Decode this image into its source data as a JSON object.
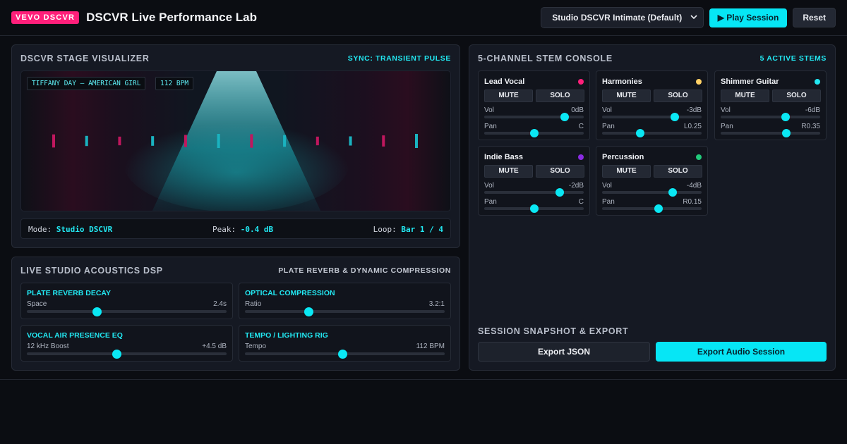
{
  "header": {
    "badge": "VEVO DSCVR",
    "title": "DSCVR Live Performance Lab",
    "preset_select": "Studio DSCVR Intimate (Default)",
    "play_button": "▶ Play Session",
    "reset_button": "Reset"
  },
  "visualizer": {
    "title": "DSCVR STAGE VISUALIZER",
    "sync": "SYNC: TRANSIENT PULSE",
    "track_chip": "TIFFANY DAY — AMERICAN GIRL",
    "bpm_chip": "112 BPM",
    "status": {
      "mode_label": "Mode:",
      "mode_value": "Studio DSCVR",
      "peak_label": "Peak:",
      "peak_value": "-0.4 dB",
      "loop_label": "Loop:",
      "loop_value": "Bar 1 / 4"
    },
    "bars": [
      {
        "color": "#c0175e",
        "level": 0.9
      },
      {
        "color": "#1ab3c0",
        "level": 0.6
      },
      {
        "color": "#c0175e",
        "level": 0.45
      },
      {
        "color": "#1ab3c0",
        "level": 0.55
      },
      {
        "color": "#c0175e",
        "level": 0.8
      },
      {
        "color": "#1ab3c0",
        "level": 1.0
      },
      {
        "color": "#c0175e",
        "level": 0.95
      },
      {
        "color": "#1ab3c0",
        "level": 0.75
      },
      {
        "color": "#c0175e",
        "level": 0.45
      },
      {
        "color": "#1ab3c0",
        "level": 0.5
      },
      {
        "color": "#c0175e",
        "level": 0.7
      },
      {
        "color": "#1ab3c0",
        "level": 1.0
      }
    ]
  },
  "dsp": {
    "title": "LIVE STUDIO ACOUSTICS DSP",
    "subtitle": "PLATE REVERB & DYNAMIC COMPRESSION",
    "controls": [
      {
        "title": "PLATE REVERB DECAY",
        "label": "Space",
        "value": "2.4s",
        "level": 0.35
      },
      {
        "title": "OPTICAL COMPRESSION",
        "label": "Ratio",
        "value": "3.2:1",
        "level": 0.32
      },
      {
        "title": "VOCAL AIR PRESENCE EQ",
        "label": "12 kHz Boost",
        "value": "+4.5 dB",
        "level": 0.45
      },
      {
        "title": "TEMPO / LIGHTING RIG",
        "label": "Tempo",
        "value": "112 BPM",
        "level": 0.49
      }
    ]
  },
  "console": {
    "title": "5-CHANNEL STEM CONSOLE",
    "active": "5 ACTIVE STEMS",
    "mute_label": "MUTE",
    "solo_label": "SOLO",
    "vol_label": "Vol",
    "pan_label": "Pan",
    "stems": [
      {
        "name": "Lead Vocal",
        "color": "#ff1f7a",
        "vol": "0dB",
        "vol_level": 0.81,
        "pan": "C",
        "pan_level": 0.5
      },
      {
        "name": "Harmonies",
        "color": "#ffd166",
        "vol": "-3dB",
        "vol_level": 0.73,
        "pan": "L0.25",
        "pan_level": 0.38
      },
      {
        "name": "Shimmer Guitar",
        "color": "#22e8f2",
        "vol": "-6dB",
        "vol_level": 0.65,
        "pan": "R0.35",
        "pan_level": 0.66
      },
      {
        "name": "Indie Bass",
        "color": "#8a2be2",
        "vol": "-2dB",
        "vol_level": 0.76,
        "pan": "C",
        "pan_level": 0.5
      },
      {
        "name": "Percussion",
        "color": "#21c97a",
        "vol": "-4dB",
        "vol_level": 0.71,
        "pan": "R0.15",
        "pan_level": 0.57
      }
    ]
  },
  "export": {
    "title": "SESSION SNAPSHOT & EXPORT",
    "json_button": "Export JSON",
    "audio_button": "Export Audio Session"
  }
}
